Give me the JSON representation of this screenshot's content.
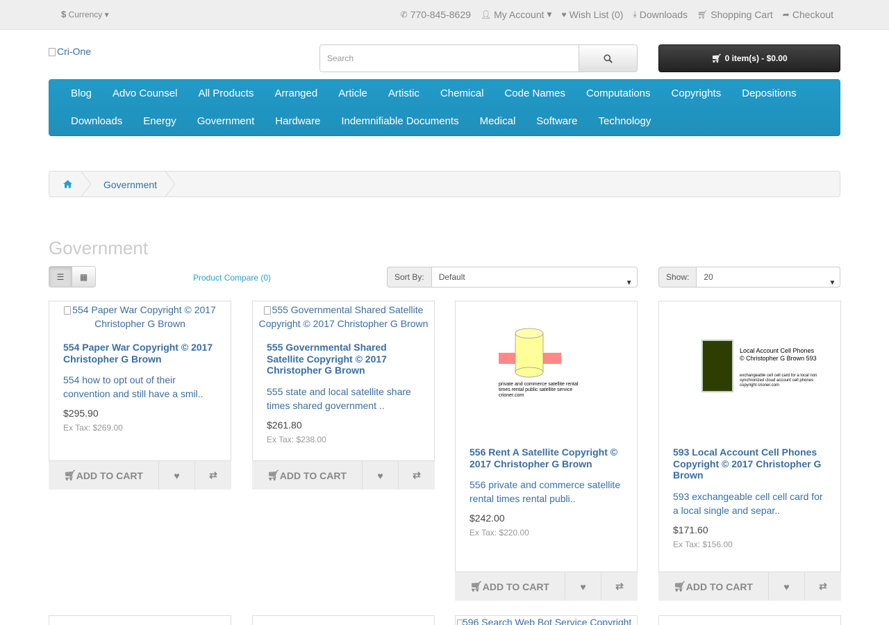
{
  "topbar": {
    "currency": "Currency",
    "phone": "770-845-8629",
    "my_account": "My Account",
    "wishlist": "Wish List (0)",
    "downloads": "Downloads",
    "cart": "Shopping Cart",
    "checkout": "Checkout"
  },
  "header": {
    "logo_alt": "Cri-One",
    "search_placeholder": "Search",
    "cart_summary": "0 item(s) - $0.00"
  },
  "menu": [
    "Blog",
    "Advo Counsel",
    "All Products",
    "Arranged",
    "Article",
    "Artistic",
    "Chemical",
    "Code Names",
    "Computations",
    "Copyrights",
    "Depositions",
    "Downloads",
    "Energy",
    "Government",
    "Hardware",
    "Indemnifiable Documents",
    "Medical",
    "Software",
    "Technology"
  ],
  "breadcrumb": {
    "current": "Government"
  },
  "page_title": "Government",
  "toolbar": {
    "compare": "Product Compare (0)",
    "sort_label": "Sort By:",
    "sort_value": "Default",
    "show_label": "Show:",
    "show_value": "20"
  },
  "products": [
    {
      "img_alt": "554 Paper War Copyright © 2017 Christopher G Brown",
      "name": "554 Paper War Copyright © 2017 Christopher G Brown",
      "desc": "554 how to opt out of their convention and still have a smil..",
      "price": "$295.90",
      "ex_tax": "Ex Tax: $269.00",
      "add_label": "ADD TO CART"
    },
    {
      "img_alt": "555 Governmental Shared Satellite Copyright © 2017 Christopher G Brown",
      "name": "555 Governmental Shared Satellite Copyright © 2017 Christopher G Brown",
      "desc": "555 state and local satellite share times shared government ..",
      "price": "$261.80",
      "ex_tax": "Ex Tax: $238.00",
      "add_label": "ADD TO CART"
    },
    {
      "img_caption": "private and commerce satellite rental times rental public satellite service crioner.com",
      "name": "556 Rent A Satellite Copyright © 2017 Christopher G Brown",
      "desc": "556 private and commerce satellite rental times rental publi..",
      "price": "$242.00",
      "ex_tax": "Ex Tax: $220.00",
      "add_label": "ADD TO CART"
    },
    {
      "img_title": "Local Account Cell Phones © Christopher G Brown 593",
      "img_caption": "exchangeable cell cell card for a local non synchronized cloud account cell phones copyright crioner.com",
      "name": "593 Local Account Cell Phones Copyright © 2017 Christopher G Brown",
      "desc": "593 exchangeable cell cell card for a local single and separ..",
      "price": "$171.60",
      "ex_tax": "Ex Tax: $156.00",
      "add_label": "ADD TO CART"
    }
  ],
  "next_row_partial": "596 Search Web Bot Service Copyright"
}
